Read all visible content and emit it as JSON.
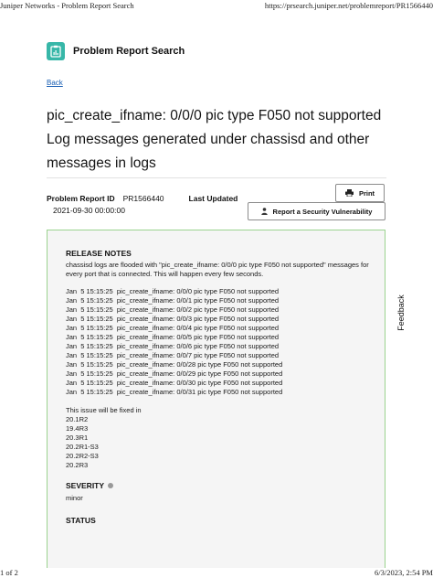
{
  "browser_header": {
    "left": "Juniper Networks - Problem Report Search",
    "right": "https://prsearch.juniper.net/problemreport/PR1566440"
  },
  "browser_footer": {
    "left": "1 of 2",
    "right": "6/3/2023, 2:54 PM"
  },
  "app": {
    "title": "Problem Report Search",
    "logo_icon": "clipboard-chart-icon",
    "brand_color": "#37b7a8"
  },
  "back_link": "Back",
  "page_title": "pic_create_ifname: 0/0/0 pic type F050 not supported Log messages generated under chassisd and other messages in logs",
  "meta": {
    "pr_id_label": "Problem Report ID",
    "pr_id_value": "PR1566440",
    "last_updated_label": "Last Updated",
    "date": "2021-09-30 00:00:00"
  },
  "buttons": {
    "print": "Print",
    "security": "Report a Security Vulnerability"
  },
  "feedback": "Feedback",
  "release_notes": {
    "heading": "RELEASE NOTES",
    "intro": "chassisd logs are flooded with \"pic_create_ifname: 0/0/0 pic type F050 not supported\" messages for every port that is connected. This will happen every few seconds.",
    "logs": [
      "Jan  5 15:15:25  pic_create_ifname: 0/0/0 pic type F050 not supported",
      "Jan  5 15:15:25  pic_create_ifname: 0/0/1 pic type F050 not supported",
      "Jan  5 15:15:25  pic_create_ifname: 0/0/2 pic type F050 not supported",
      "Jan  5 15:15:25  pic_create_ifname: 0/0/3 pic type F050 not supported",
      "Jan  5 15:15:25  pic_create_ifname: 0/0/4 pic type F050 not supported",
      "Jan  5 15:15:25  pic_create_ifname: 0/0/5 pic type F050 not supported",
      "Jan  5 15:15:25  pic_create_ifname: 0/0/6 pic type F050 not supported",
      "Jan  5 15:15:25  pic_create_ifname: 0/0/7 pic type F050 not supported",
      "Jan  5 15:15:25  pic_create_ifname: 0/0/28 pic type F050 not supported",
      "Jan  5 15:15:25  pic_create_ifname: 0/0/29 pic type F050 not supported",
      "Jan  5 15:15:25  pic_create_ifname: 0/0/30 pic type F050 not supported",
      "Jan  5 15:15:25  pic_create_ifname: 0/0/31 pic type F050 not supported"
    ],
    "fixed_in_label": "This issue will be fixed in",
    "fixed_in": [
      "20.1R2",
      "19.4R3",
      "20.3R1",
      "20.2R1-S3",
      "20.2R2-S3",
      "20.2R3"
    ]
  },
  "severity": {
    "heading": "SEVERITY",
    "value": "minor"
  },
  "status": {
    "heading": "STATUS"
  }
}
